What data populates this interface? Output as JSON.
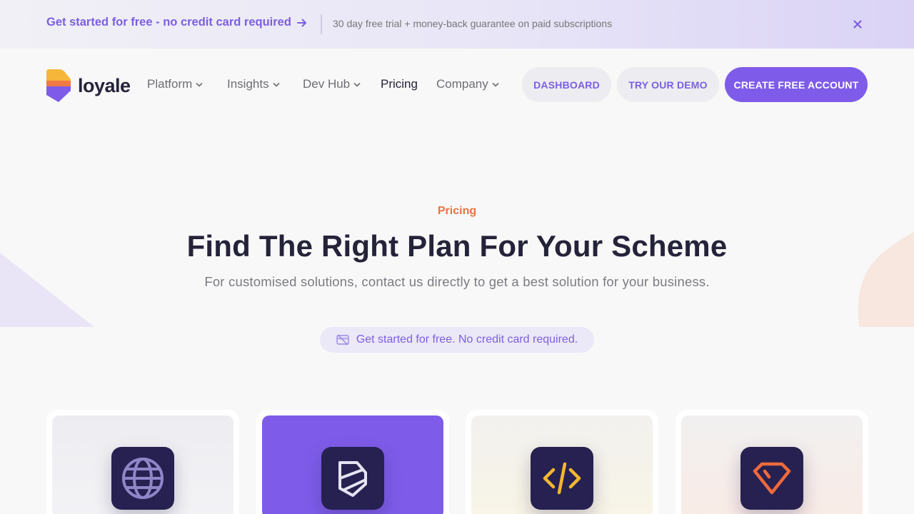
{
  "announcement": {
    "link_text": "Get started for free - no credit card required",
    "note": "30 day free trial + money-back guarantee on paid subscriptions"
  },
  "header": {
    "logo_text": "loyale",
    "nav": [
      {
        "label": "Platform",
        "dropdown": true
      },
      {
        "label": "Insights",
        "dropdown": true
      },
      {
        "label": "Dev Hub",
        "dropdown": true
      },
      {
        "label": "Pricing",
        "dropdown": false
      },
      {
        "label": "Company",
        "dropdown": true
      }
    ],
    "buttons": {
      "dashboard": "DASHBOARD",
      "demo": "TRY OUR DEMO",
      "create": "CREATE FREE ACCOUNT"
    }
  },
  "hero": {
    "eyebrow": "Pricing",
    "title": "Find The Right Plan For Your Scheme",
    "subtitle": "For customised solutions, contact us directly to get a best solution for your business.",
    "pill_text": "Get started for free. No credit card required."
  },
  "cards": [
    {
      "icon": "globe-icon"
    },
    {
      "icon": "loyale-logo-icon"
    },
    {
      "icon": "code-icon"
    },
    {
      "icon": "diamond-icon"
    }
  ],
  "colors": {
    "primary": "#7e5ce9",
    "accent_orange": "#ec7245",
    "dark": "#25233a",
    "icon_bg": "#262150"
  }
}
